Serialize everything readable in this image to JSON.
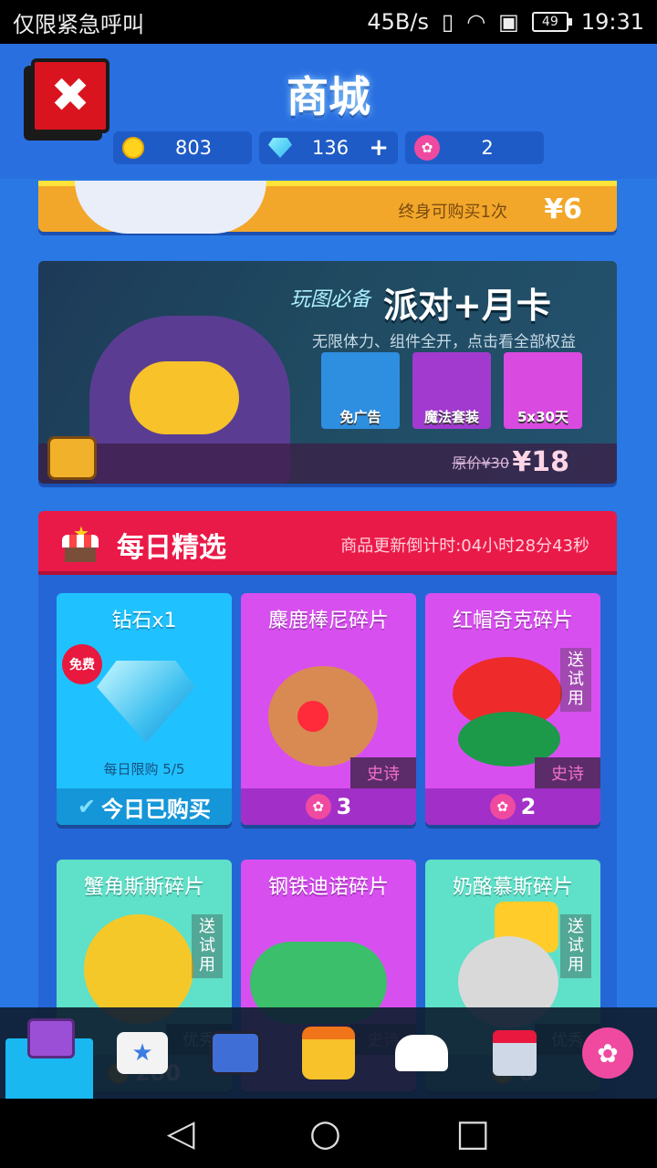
{
  "status_bar": {
    "carrier_text": "仅限紧急呼叫",
    "net_speed": "45B/s",
    "battery": "49",
    "time": "19:31"
  },
  "header": {
    "title": "商城",
    "close_icon": "close-icon",
    "currencies": [
      {
        "icon": "coin-icon",
        "value": "803"
      },
      {
        "icon": "diamond-icon",
        "value": "136",
        "action": "+"
      },
      {
        "icon": "lotus-icon",
        "value": "2"
      }
    ]
  },
  "pack_lifetime": {
    "limit": "终身可购买1次",
    "price": "¥6"
  },
  "party_card": {
    "slogan": "玩图必备",
    "title": "派对+月卡",
    "subtitle": "无限体力、组件全开，点击看全部权益",
    "benefits": [
      "免广告",
      "魔法套装",
      "5x30天"
    ],
    "old_price": "原价¥30",
    "price": "¥18"
  },
  "daily": {
    "title": "每日精选",
    "timer": "商品更新倒计时:04小时28分43秒",
    "items": [
      {
        "name": "钻石x1",
        "badge": "免费",
        "limit": "每日限购 5/5",
        "status": "今日已购买"
      },
      {
        "name": "麋鹿棒尼碎片",
        "rarity": "史诗",
        "cost": "3"
      },
      {
        "name": "红帽奇克碎片",
        "rarity": "史诗",
        "cost": "2",
        "trial": "送试用"
      },
      {
        "name": "蟹角斯斯碎片",
        "rarity": "优秀",
        "cost": "200",
        "trial": "送试用"
      },
      {
        "name": "钢铁迪诺碎片",
        "rarity": "史诗"
      },
      {
        "name": "奶酪慕斯碎片",
        "rarity": "优秀",
        "cost": "0",
        "trial": "送试用"
      }
    ]
  },
  "colors": {
    "background": "#2a78e4",
    "daily_header": "#ea1a48",
    "diamond_card": "#1fc2ff",
    "purple_card": "#d84ff0",
    "mint_card": "#5fe0c8"
  }
}
